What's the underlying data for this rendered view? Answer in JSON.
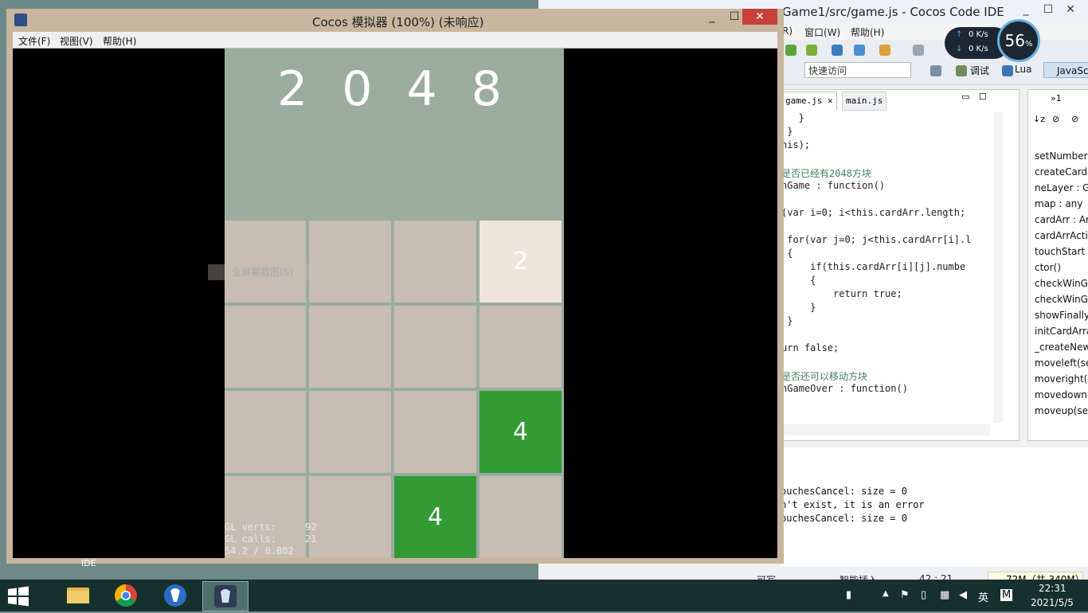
{
  "ide": {
    "title": "Game1/src/game.js - Cocos Code IDE",
    "menu": [
      "R)",
      "窗口(W)",
      "帮助(H)"
    ],
    "quick_access": "快速访问",
    "perspectives": [
      "调试",
      "Lua",
      "JavaScr"
    ],
    "tabs": [
      "game.js",
      "main.js"
    ],
    "code_lines": [
      "   }",
      " }",
      "his);",
      "",
      "是否已经有2048方块",
      "nGame : function()",
      "",
      "(var i=0; i<this.cardArr.length;",
      "",
      " for(var j=0; j<this.cardArr[i].l",
      " {",
      "     if(this.cardArr[i][j].numbe",
      "     {",
      "         return true;",
      "     }",
      " }",
      "",
      "urn false;",
      "",
      "是否还可以移动方块",
      "nGameOver : function()"
    ],
    "outline_tab": "»1",
    "outline_items": [
      "setNumber(",
      "createCard(",
      "neLayer : Ga",
      "map : any",
      "cardArr : Ar",
      "cardArrActio",
      "touchStart :",
      "ctor()",
      "checkWinGa",
      "checkWinGa",
      "showFinally",
      "initCardArra",
      "_createNew",
      "moveleft(se",
      "moveright(s",
      "movedown(",
      "moveup(sel"
    ],
    "console_lines": [
      "ouchesCancel: size = 0",
      "n't exist, it is an error",
      "ouchesCancel: size = 0"
    ],
    "status": {
      "writable": "可写",
      "insert": "智能插入",
      "position": "42 : 21",
      "memory": "72M（共 340M）"
    }
  },
  "netmeter": {
    "up": "0 K/s",
    "down": "0 K/s",
    "percent": "56",
    "unit": "%"
  },
  "simulator": {
    "title": "Cocos 模拟器 (100%) (未响应)",
    "menu": [
      "文件(F)",
      "视图(V)",
      "帮助(H)"
    ],
    "context_item": "全屏幕截图(S)",
    "game": {
      "title": "2 0 4 8",
      "board": [
        [
          "",
          "",
          "",
          "2"
        ],
        [
          "",
          "",
          "",
          ""
        ],
        [
          "",
          "",
          "",
          "4"
        ],
        [
          "",
          "",
          "4",
          ""
        ]
      ]
    },
    "debug": [
      "GL verts:     92",
      "GL calls:     21",
      "54.2 / 0.002"
    ]
  },
  "taskbar": {
    "desktop_label": "IDE",
    "apps": [
      "file-explorer",
      "chrome",
      "cocos-launcher",
      "cocos-simulator"
    ],
    "tray": {
      "ime": "英",
      "ime2": "M"
    },
    "time": "22:31",
    "date": "2021/5/5"
  },
  "colors": {
    "tile2": "#efe4d9",
    "tile4": "#339b36",
    "empty": "#c7bdb2",
    "board_bg": "#9aaca0",
    "close": "#c7403a"
  }
}
